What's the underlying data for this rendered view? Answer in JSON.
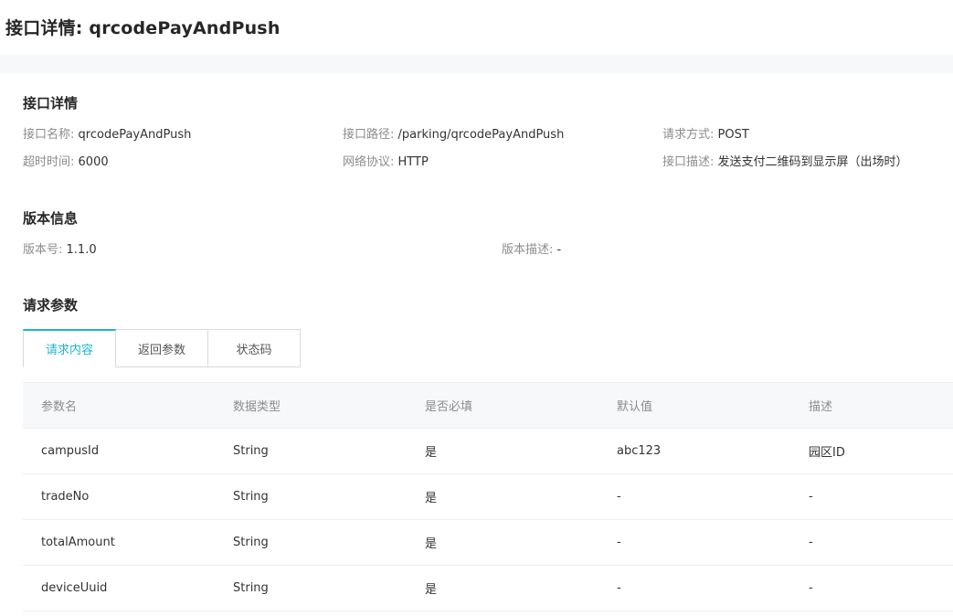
{
  "page_title": "接口详情: qrcodePayAndPush",
  "interface_details": {
    "title": "接口详情",
    "fields": [
      {
        "label": "接口名称:",
        "value": "qrcodePayAndPush"
      },
      {
        "label": "接口路径:",
        "value": "/parking/qrcodePayAndPush"
      },
      {
        "label": "请求方式:",
        "value": "POST"
      },
      {
        "label": "超时时间:",
        "value": "6000"
      },
      {
        "label": "网络协议:",
        "value": "HTTP"
      },
      {
        "label": "接口描述:",
        "value": "发送支付二维码到显示屏（出场时）"
      }
    ]
  },
  "version_info": {
    "title": "版本信息",
    "fields": [
      {
        "label": "版本号:",
        "value": "1.1.0"
      },
      {
        "label": "版本描述:",
        "value": "-"
      }
    ]
  },
  "request_params": {
    "title": "请求参数",
    "tabs": [
      {
        "label": "请求内容",
        "active": true
      },
      {
        "label": "返回参数",
        "active": false
      },
      {
        "label": "状态码",
        "active": false
      }
    ],
    "table": {
      "headers": [
        "参数名",
        "数据类型",
        "是否必填",
        "默认值",
        "描述"
      ],
      "rows": [
        [
          "campusId",
          "String",
          "是",
          "abc123",
          "园区ID"
        ],
        [
          "tradeNo",
          "String",
          "是",
          "-",
          "-"
        ],
        [
          "totalAmount",
          "String",
          "是",
          "-",
          "-"
        ],
        [
          "deviceUuid",
          "String",
          "是",
          "-",
          "-"
        ]
      ]
    }
  },
  "colors": {
    "accent": "#1fb6d0",
    "background_band": "#f7f8fa"
  }
}
